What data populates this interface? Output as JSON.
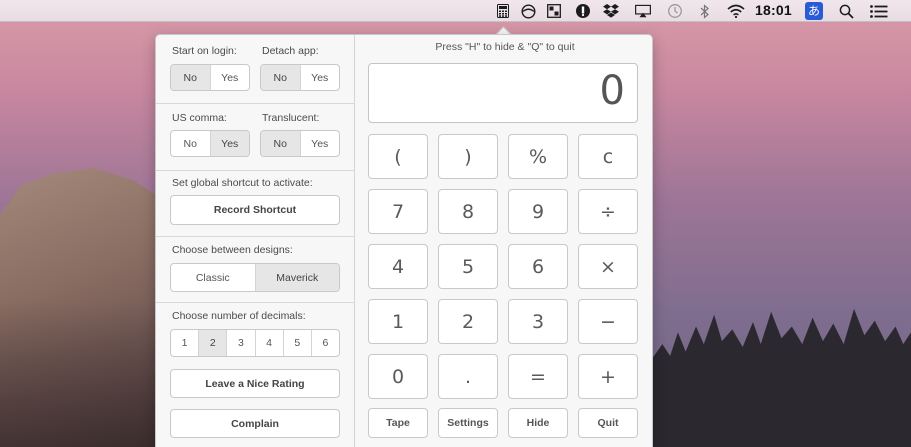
{
  "menubar": {
    "clock": "18:01",
    "input_method": "あ",
    "icons": [
      "calculator-icon",
      "sleep-icon",
      "window-icon",
      "password-icon",
      "dropbox-icon",
      "airplay-icon",
      "time-machine-icon",
      "bluetooth-icon",
      "wifi-icon",
      "input-method-icon",
      "spotlight-icon",
      "notification-center-icon"
    ]
  },
  "settings": {
    "start_on_login": {
      "label": "Start on login:",
      "options": [
        "No",
        "Yes"
      ],
      "selected": "No"
    },
    "detach_app": {
      "label": "Detach app:",
      "options": [
        "No",
        "Yes"
      ],
      "selected": "No"
    },
    "us_comma": {
      "label": "US comma:",
      "options": [
        "No",
        "Yes"
      ],
      "selected": "Yes"
    },
    "translucent": {
      "label": "Translucent:",
      "options": [
        "No",
        "Yes"
      ],
      "selected": "No"
    },
    "shortcut": {
      "label": "Set global shortcut to activate:",
      "button": "Record Shortcut"
    },
    "design": {
      "label": "Choose between designs:",
      "options": [
        "Classic",
        "Maverick"
      ],
      "selected": "Maverick"
    },
    "decimals": {
      "label": "Choose number of decimals:",
      "options": [
        "1",
        "2",
        "3",
        "4",
        "5",
        "6"
      ],
      "selected": "2"
    },
    "rate_button": "Leave a Nice Rating",
    "complain_button": "Complain"
  },
  "calculator": {
    "hint": "Press \"H\" to hide & \"Q\" to quit",
    "display": "0",
    "keys": [
      [
        "(",
        ")",
        "%",
        "c"
      ],
      [
        "7",
        "8",
        "9",
        "÷"
      ],
      [
        "4",
        "5",
        "6",
        "×"
      ],
      [
        "1",
        "2",
        "3",
        "−"
      ],
      [
        "0",
        ".",
        "=",
        "+"
      ]
    ],
    "footer": [
      "Tape",
      "Settings",
      "Hide",
      "Quit"
    ]
  }
}
